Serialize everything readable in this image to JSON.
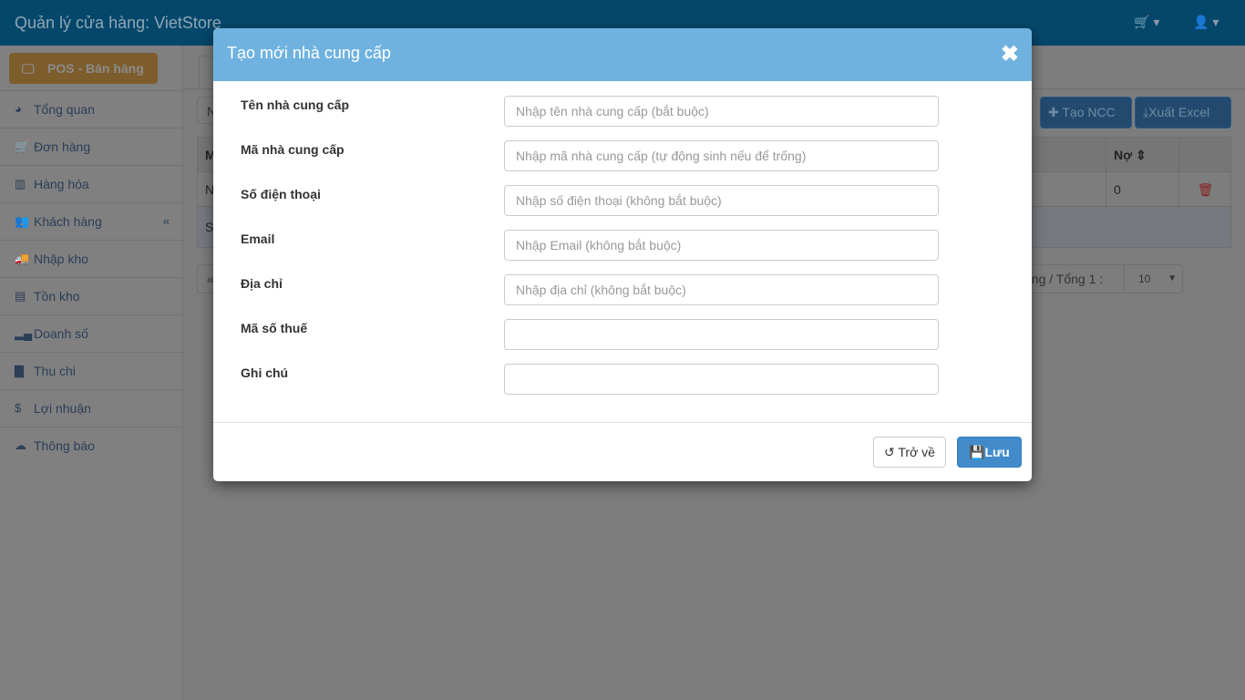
{
  "navbar": {
    "title": "Quản lý cửa hàng: VietStore",
    "cart_icon": "cart-icon",
    "user_icon": "user-icon"
  },
  "sidebar": {
    "pos_button": "POS - Bán hàng",
    "items": [
      {
        "label": "Tổng quan",
        "icon": "dashboard-icon"
      },
      {
        "label": "Đơn hàng",
        "icon": "cart-icon"
      },
      {
        "label": "Hàng hóa",
        "icon": "barcode-icon"
      },
      {
        "label": "Khách hàng",
        "icon": "users-icon"
      },
      {
        "label": "Nhập kho",
        "icon": "truck-icon"
      },
      {
        "label": "Tồn kho",
        "icon": "list-icon"
      },
      {
        "label": "Doanh số",
        "icon": "signal-icon"
      },
      {
        "label": "Thu chi",
        "icon": "file-icon"
      },
      {
        "label": "Lợi nhuận",
        "icon": "dollar-icon"
      },
      {
        "label": "Thông báo",
        "icon": "cloud-icon"
      }
    ],
    "collapse": "«"
  },
  "main": {
    "search_value": "N",
    "create_button": "Tạo NCC",
    "export_button": "Xuất Excel",
    "table": {
      "header_first": "M",
      "header_debt": "Nợ",
      "row_first": "N",
      "row_debt": "0",
      "summary_first": "S"
    },
    "pagination": {
      "prev": "«",
      "info": "òng / Tổng 1 :",
      "page_size": "10"
    }
  },
  "modal": {
    "title": "Tạo mới nhà cung cấp",
    "fields": [
      {
        "label": "Tên nhà cung cấp",
        "placeholder": "Nhập tên nhà cung cấp (bắt buộc)"
      },
      {
        "label": "Mã nhà cung cấp",
        "placeholder": "Nhập mã nhà cung cấp (tự động sinh nếu để trống)"
      },
      {
        "label": "Số điện thoại",
        "placeholder": "Nhập số điện thoại (không bắt buộc)"
      },
      {
        "label": "Email",
        "placeholder": "Nhập Email (không bắt buộc)"
      },
      {
        "label": "Địa chỉ",
        "placeholder": "Nhập địa chỉ (không bắt buộc)"
      },
      {
        "label": "Mã số thuế",
        "placeholder": ""
      },
      {
        "label": "Ghi chú",
        "placeholder": ""
      }
    ],
    "back_button": "Trở về",
    "save_button": "Lưu"
  }
}
